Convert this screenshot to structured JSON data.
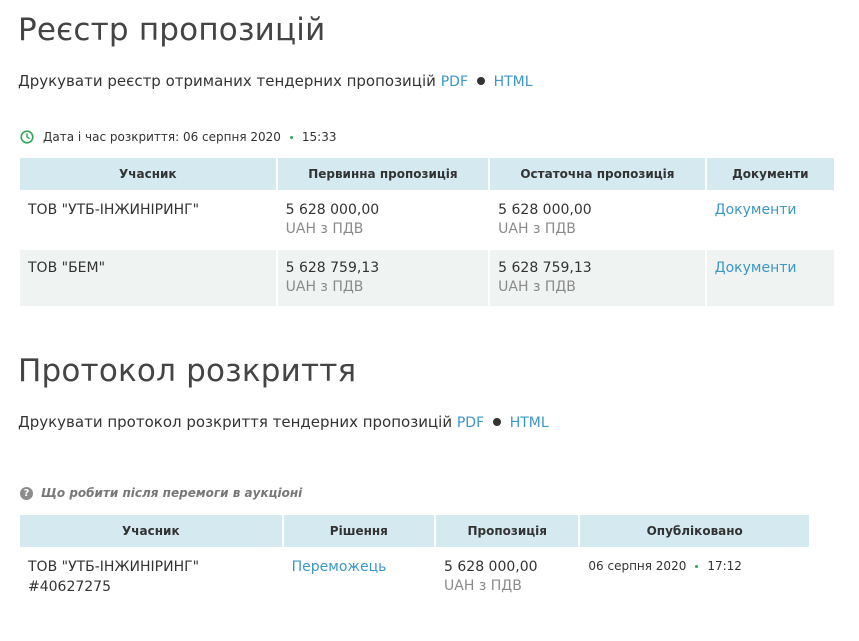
{
  "registry": {
    "title": "Реєстр пропозицій",
    "print_text": "Друкувати реєстр отриманих тендерних пропозицій",
    "pdf_label": "PDF",
    "html_label": "HTML",
    "opening_label": "Дата і час розкриття: 06 серпня 2020",
    "opening_time": "15:33",
    "columns": [
      "Учасник",
      "Первинна пропозиція",
      "Остаточна пропозиція",
      "Документи"
    ],
    "rows": [
      {
        "participant": "ТОВ \"УТБ-ІНЖИНІРИНГ\"",
        "initial": "5 628 000,00",
        "initial_unit": "UAH з ПДВ",
        "final": "5 628 000,00",
        "final_unit": "UAH з ПДВ",
        "docs": "Документи"
      },
      {
        "participant": "ТОВ \"БЕМ\"",
        "initial": "5 628 759,13",
        "initial_unit": "UAH з ПДВ",
        "final": "5 628 759,13",
        "final_unit": "UAH з ПДВ",
        "docs": "Документи"
      }
    ]
  },
  "protocol": {
    "title": "Протокол розкриття",
    "print_text": "Друкувати протокол розкриття тендерних пропозицій",
    "pdf_label": "PDF",
    "html_label": "HTML",
    "help_link": "Що робити після перемоги в аукціоні",
    "columns": [
      "Учасник",
      "Рішення",
      "Пропозиція",
      "Опубліковано"
    ],
    "rows": [
      {
        "participant": "ТОВ \"УТБ-ІНЖИНІРИНГ\"",
        "edrpou": "#40627275",
        "decision": "Переможець",
        "offer": "5 628 000,00",
        "offer_unit": "UAH з ПДВ",
        "published_date": "06 серпня 2020",
        "published_time": "17:12"
      }
    ]
  },
  "colors": {
    "link": "#3b97c7",
    "header_bg": "#d4e9f0",
    "alt_row_bg": "#eff3f1",
    "clock_green": "#35a55a"
  },
  "icons": [
    "clock-icon",
    "question-icon"
  ]
}
